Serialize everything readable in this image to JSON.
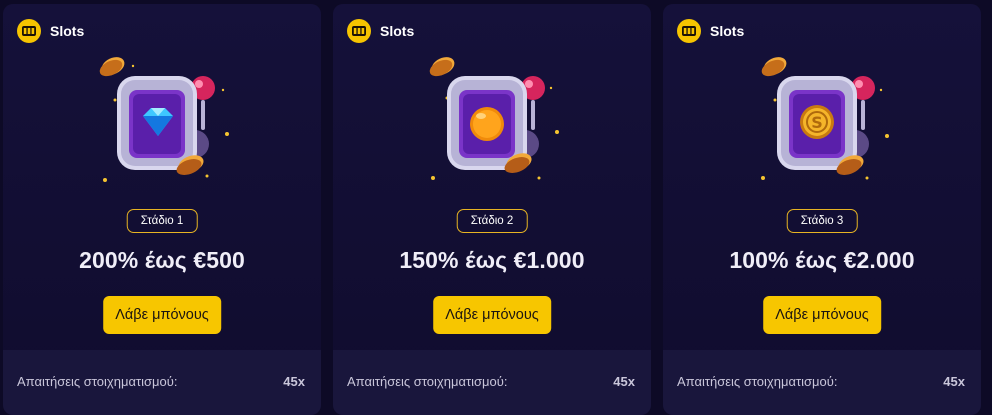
{
  "cards": [
    {
      "category": "Slots",
      "category_icon": "slot-machine-icon",
      "illustration": "slot-machine-diamond",
      "stage": "Στάδιο 1",
      "offer": "200% έως €500",
      "button": "Λάβε μπόνους",
      "requirements_label": "Απαιτήσεις στοιχηματισμού:",
      "requirements_value": "45x"
    },
    {
      "category": "Slots",
      "category_icon": "slot-machine-icon",
      "illustration": "slot-machine-orange",
      "stage": "Στάδιο 2",
      "offer": "150% έως €1.000",
      "button": "Λάβε μπόνους",
      "requirements_label": "Απαιτήσεις στοιχηματισμού:",
      "requirements_value": "45x"
    },
    {
      "category": "Slots",
      "category_icon": "slot-machine-icon",
      "illustration": "slot-machine-coin",
      "stage": "Στάδιο 3",
      "offer": "100% έως €2.000",
      "button": "Λάβε μπόνους",
      "requirements_label": "Απαιτήσεις στοιχηματισμού:",
      "requirements_value": "45x"
    }
  ],
  "colors": {
    "background": "#0d0a26",
    "card": "#14103a",
    "accent_yellow": "#f7c600",
    "badge_border": "#e7b423",
    "footer_row": "#19163c"
  }
}
